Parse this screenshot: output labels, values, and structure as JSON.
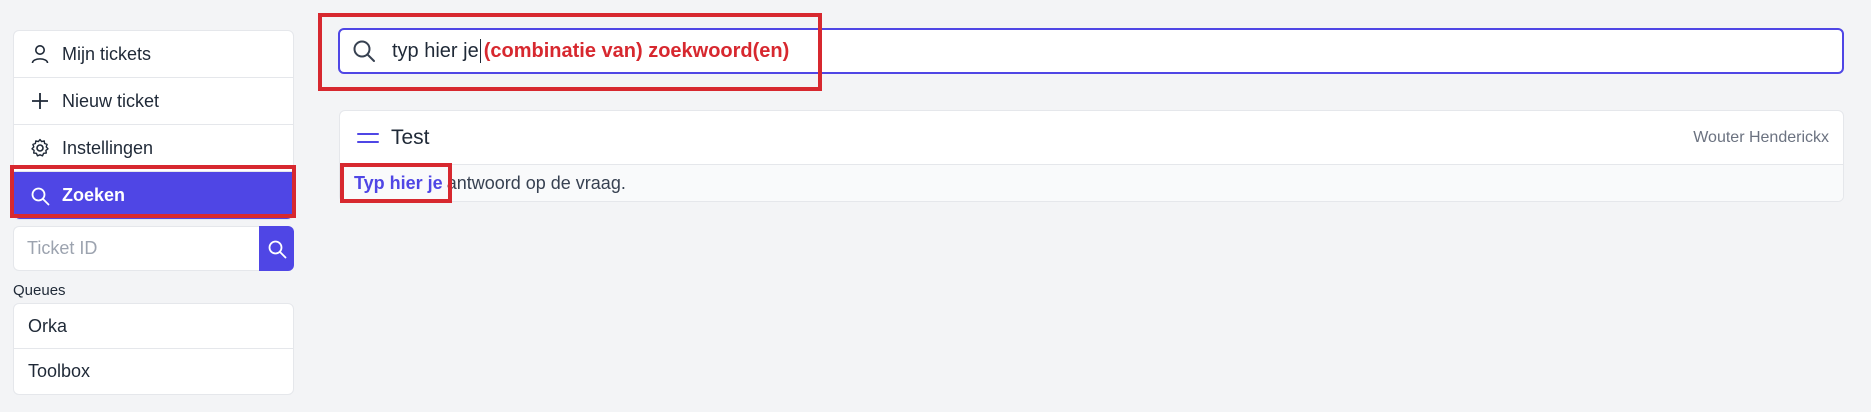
{
  "sidebar": {
    "nav": [
      {
        "label": "Mijn tickets",
        "icon": "user-icon"
      },
      {
        "label": "Nieuw ticket",
        "icon": "plus-icon"
      },
      {
        "label": "Instellingen",
        "icon": "gear-icon"
      },
      {
        "label": "Zoeken",
        "icon": "search-icon",
        "active": true
      }
    ],
    "ticket_search": {
      "placeholder": "Ticket ID",
      "value": "",
      "button_icon": "search-icon"
    },
    "queues_label": "Queues",
    "queues": [
      {
        "label": "Orka"
      },
      {
        "label": "Toolbox"
      }
    ]
  },
  "search": {
    "value": "typ hier je",
    "icon": "search-icon"
  },
  "annotation": {
    "text": "(combinatie van) zoekwoord(en)",
    "color": "#d7282f"
  },
  "results": [
    {
      "title": "Test",
      "author": "Wouter Henderickx",
      "match": "Typ hier je",
      "rest": "antwoord op de vraag."
    }
  ],
  "colors": {
    "accent": "#4f46e5",
    "annotation_red": "#d7282f",
    "background": "#f3f4f6"
  }
}
